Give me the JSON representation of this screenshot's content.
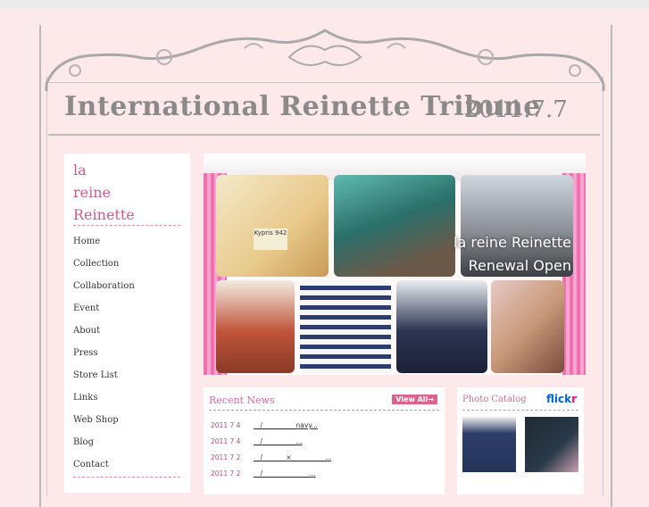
{
  "header": {
    "title": "International Reinette Tribune",
    "date": "2011.7.7"
  },
  "sidebar": {
    "logo_lines": [
      "la",
      "reine",
      "Reinette"
    ],
    "nav": [
      {
        "label": "Home"
      },
      {
        "label": "Collection"
      },
      {
        "label": "Collaboration"
      },
      {
        "label": "Event"
      },
      {
        "label": "About"
      },
      {
        "label": "Press"
      },
      {
        "label": "Store List"
      },
      {
        "label": "Links"
      },
      {
        "label": "Web Shop"
      },
      {
        "label": "Blog"
      },
      {
        "label": "Contact"
      }
    ]
  },
  "hero": {
    "line1": "la reine Reinette",
    "line2": "Renewal Open",
    "tag_text": "Kypris 942"
  },
  "news": {
    "title": "Recent News",
    "view_all": "View All→",
    "items": [
      {
        "date": "2011  7  4",
        "text": "__/__________navy..."
      },
      {
        "date": "2011  7  4",
        "text": "__/__________..."
      },
      {
        "date": "2011  7  2",
        "text": "__/_______×__________..."
      },
      {
        "date": "2011  7  2",
        "text": "__/______________..."
      }
    ]
  },
  "catalog": {
    "title": "Photo Catalog",
    "brand_blue": "flick",
    "brand_pink": "r"
  },
  "colors": {
    "accent": "#d05a8a",
    "background": "#fde8ea",
    "frame": "#b8b8b8"
  }
}
